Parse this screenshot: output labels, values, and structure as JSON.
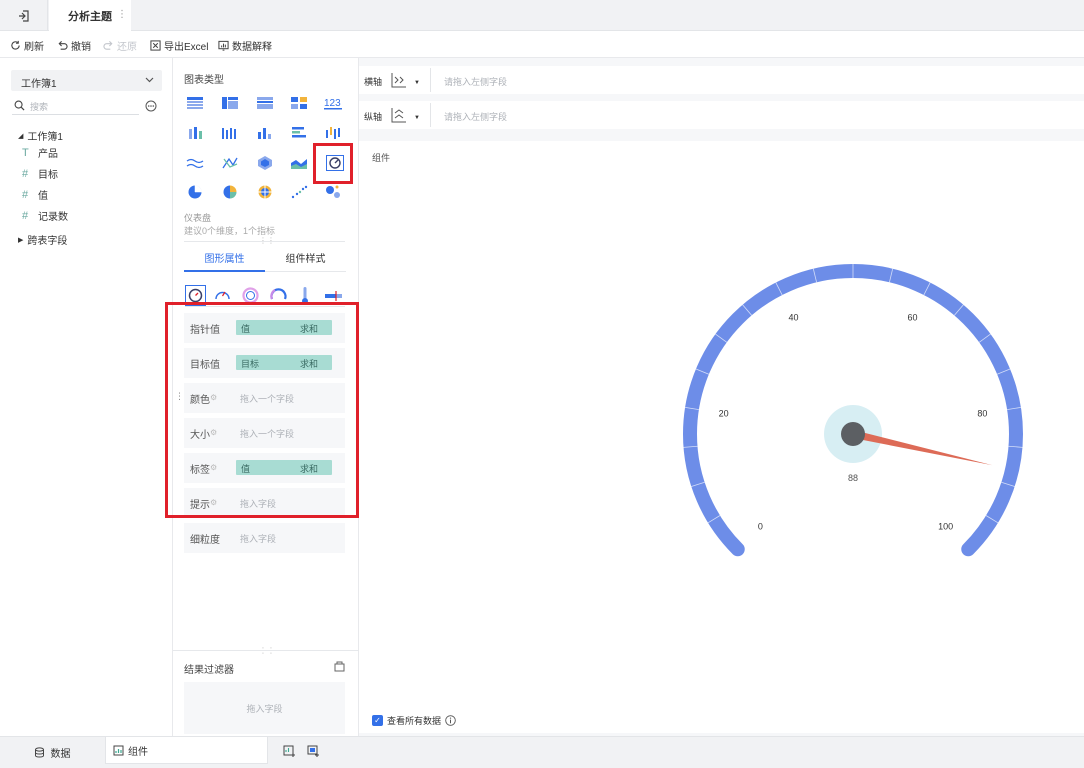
{
  "topbar": {
    "title": "分析主题",
    "back_icon": "exit-icon"
  },
  "toolbar": {
    "refresh": "刷新",
    "undo": "撤销",
    "redo": "还原",
    "export": "导出Excel",
    "explain": "数据解释"
  },
  "left": {
    "workbook_select": "工作簿1",
    "search_placeholder": "搜索",
    "tree_root": "工作簿1",
    "fields": [
      {
        "glyph": "T",
        "label": "产品"
      },
      {
        "glyph": "#",
        "label": "目标"
      },
      {
        "glyph": "#",
        "label": "值"
      },
      {
        "glyph": "#",
        "label": "记录数"
      }
    ],
    "cross_table": "跨表字段"
  },
  "mid": {
    "chart_type_title": "图表类型",
    "chart_type_name": "仪表盘",
    "chart_type_hint": "建议0个维度，1个指标",
    "tabs": [
      "图形属性",
      "组件样式"
    ],
    "rows": [
      {
        "label": "指针值",
        "pill": {
          "field": "值",
          "agg": "求和"
        }
      },
      {
        "label": "目标值",
        "pill": {
          "field": "目标",
          "agg": "求和"
        }
      },
      {
        "label": "颜色",
        "placeholder": "拖入一个字段"
      },
      {
        "label": "大小",
        "placeholder": "拖入一个字段"
      },
      {
        "label": "标签",
        "pill": {
          "field": "值",
          "agg": "求和"
        }
      },
      {
        "label": "提示",
        "placeholder": "拖入字段"
      },
      {
        "label": "细粒度",
        "placeholder": "拖入字段"
      }
    ],
    "result_filter": "结果过滤器",
    "filter_placeholder": "拖入字段",
    "accent": "#3370e8"
  },
  "right": {
    "x_axis": {
      "label": "横轴",
      "placeholder": "请拖入左侧字段"
    },
    "y_axis": {
      "label": "纵轴",
      "placeholder": "请拖入左侧字段"
    },
    "component_label": "组件",
    "view_all": "查看所有数据"
  },
  "gauge": {
    "min": 0,
    "max": 100,
    "value": 88,
    "value_label": "88",
    "ticks": [
      "0",
      "20",
      "40",
      "60",
      "80",
      "100"
    ],
    "band_color": "#6d8de8",
    "needle_color": "#dd6b57",
    "hub_color": "#5c5f63",
    "halo_color": "#d7eef3"
  },
  "bottom": {
    "data_tab": "数据",
    "component_tab": "组件"
  }
}
